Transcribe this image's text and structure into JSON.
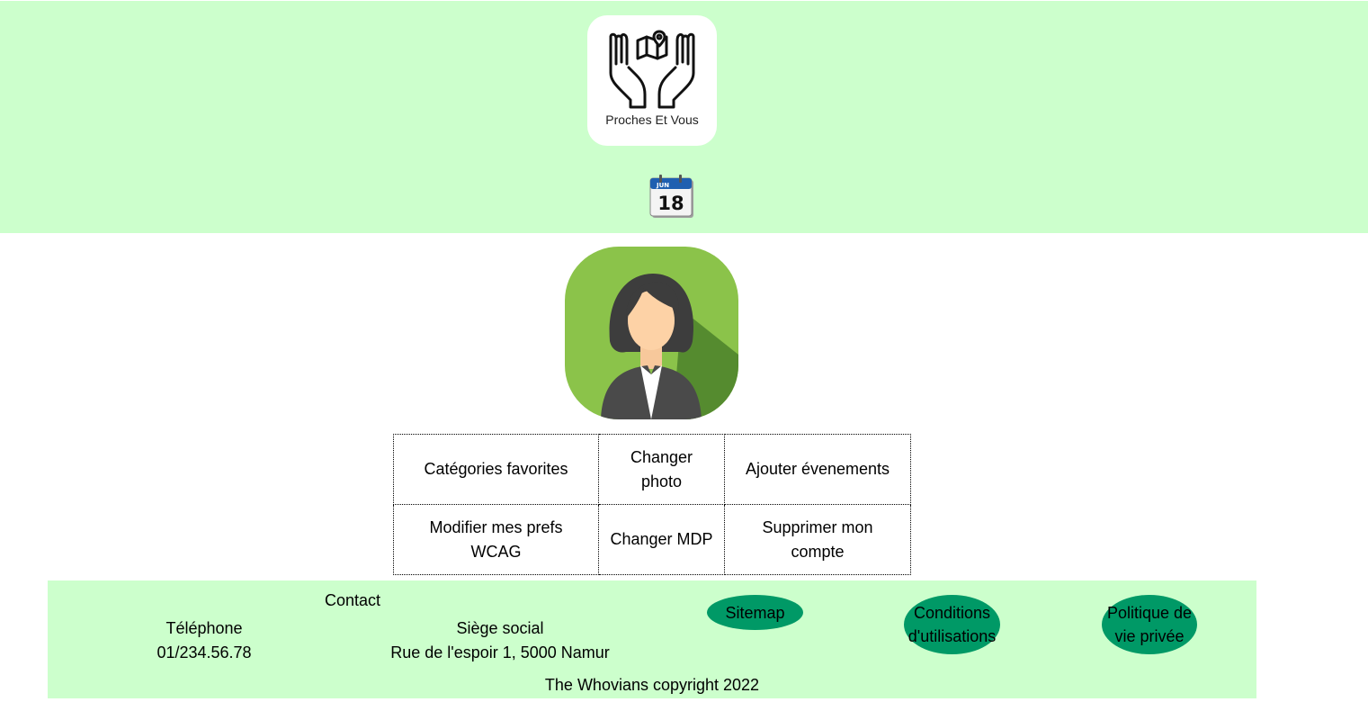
{
  "header": {
    "logo": {
      "icon": "hands-map-pin-logo",
      "text": "Proches Et Vous"
    },
    "calendar": {
      "icon": "calendar-icon",
      "month": "JUN",
      "day": "18"
    },
    "background": "#ccffcc"
  },
  "profile": {
    "avatar_icon": "woman-avatar",
    "avatar_color": "#8bc34a"
  },
  "menu": {
    "rows": [
      [
        "Catégories favorites",
        "Changer photo",
        "Ajouter évenements"
      ],
      [
        "Modifier mes prefs WCAG",
        "Changer MDP",
        "Supprimer mon compte"
      ]
    ]
  },
  "footer": {
    "contact_title": "Contact",
    "phone_label": "Téléphone",
    "phone_value": "01/234.56.78",
    "office_label": "Siège social",
    "office_value": "Rue de l'espoir 1, 5000 Namur",
    "links": [
      "Sitemap",
      "Conditions d'utilisations",
      "Politique de vie privée"
    ],
    "copyright": "The Whovians copyright 2022",
    "pill_color": "#009966"
  }
}
